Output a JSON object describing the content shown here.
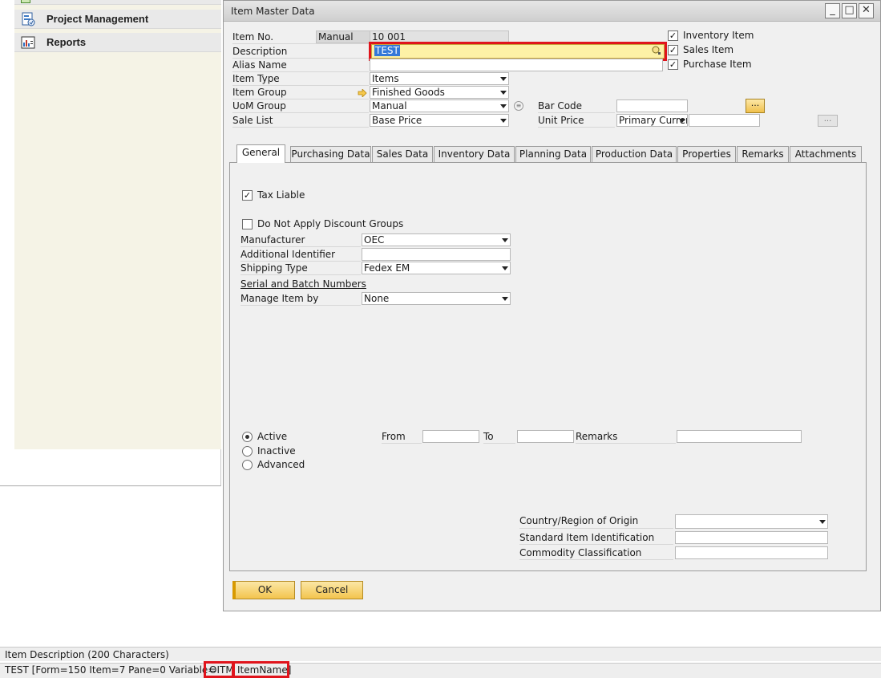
{
  "left_panel": {
    "items": [
      {
        "label": "Project Management",
        "icon": "project-management-icon"
      },
      {
        "label": "Reports",
        "icon": "reports-icon"
      }
    ]
  },
  "window": {
    "title": "Item Master Data",
    "controls": {
      "minimize": "_",
      "maximize": "□",
      "close": "✕"
    }
  },
  "header": {
    "item_no_label": "Item No.",
    "item_no_series": "Manual",
    "item_no_value": "10 001",
    "description_label": "Description",
    "description_value": "TEST",
    "alias_label": "Alias Name",
    "alias_value": "",
    "item_type_label": "Item Type",
    "item_type_value": "Items",
    "item_group_label": "Item Group",
    "item_group_value": "Finished Goods",
    "uom_group_label": "UoM Group",
    "uom_group_value": "Manual",
    "sale_list_label": "Sale List",
    "sale_list_value": "Base Price",
    "bar_code_label": "Bar Code",
    "bar_code_value": "",
    "bar_code_btn": "...",
    "unit_price_label": "Unit Price",
    "unit_price_currency": "Primary Currer",
    "unit_price_value": "",
    "unit_price_btn": "...",
    "inventory_item_label": "Inventory Item",
    "sales_item_label": "Sales Item",
    "purchase_item_label": "Purchase Item"
  },
  "tabs": [
    "General",
    "Purchasing Data",
    "Sales Data",
    "Inventory Data",
    "Planning Data",
    "Production Data",
    "Properties",
    "Remarks",
    "Attachments"
  ],
  "general": {
    "tax_liable_label": "Tax Liable",
    "no_discount_label": "Do Not Apply Discount Groups",
    "manufacturer_label": "Manufacturer",
    "manufacturer_value": "OEC",
    "additional_id_label": "Additional Identifier",
    "additional_id_value": "",
    "shipping_type_label": "Shipping Type",
    "shipping_type_value": "Fedex EM",
    "serial_batch_label": "Serial and Batch Numbers",
    "manage_by_label": "Manage Item by",
    "manage_by_value": "None",
    "active_label": "Active",
    "inactive_label": "Inactive",
    "advanced_label": "Advanced",
    "from_label": "From",
    "to_label": "To",
    "remarks_label": "Remarks",
    "country_label": "Country/Region of Origin",
    "std_item_label": "Standard Item Identification",
    "commodity_label": "Commodity Classification"
  },
  "buttons": {
    "ok": "OK",
    "cancel": "Cancel"
  },
  "status": {
    "line1": "Item Description (200 Characters)",
    "line2_prefix": "TEST  [Form=150 Item=7 Pane=0 Variable=",
    "line2_table": "OITM",
    "line2_field": "ItemName]"
  },
  "colors": {
    "highlight_red": "#e0141c",
    "selection_blue": "#3478d8",
    "active_field_yellow": "#fdf1a6",
    "button_gold": "#f3c44e"
  }
}
